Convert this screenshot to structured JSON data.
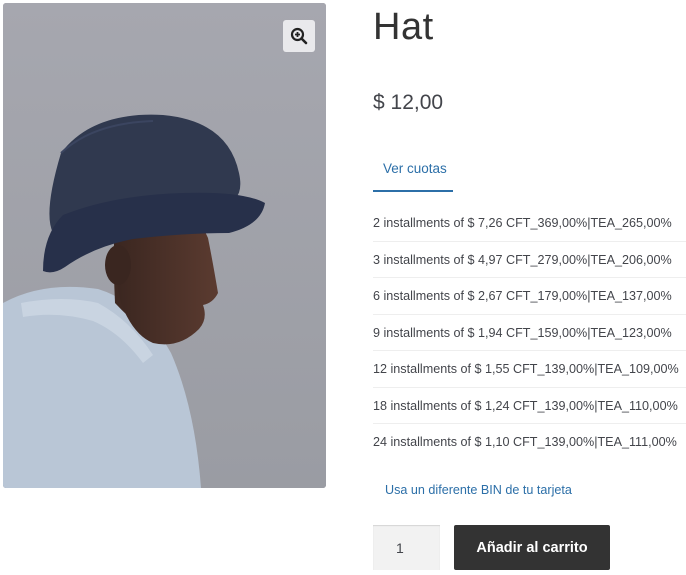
{
  "product": {
    "title": "Hat",
    "price": "$ 12,00",
    "image_alt": "Man wearing a navy bucket hat",
    "zoom_icon": "zoom-in-icon"
  },
  "installments_tab": {
    "label": "Ver cuotas",
    "items": [
      "2 installments of $ 7,26 CFT_369,00%|TEA_265,00%",
      "3 installments of $ 4,97 CFT_279,00%|TEA_206,00%",
      "6 installments of $ 2,67 CFT_179,00%|TEA_137,00%",
      "9 installments of $ 1,94 CFT_159,00%|TEA_123,00%",
      "12 installments of $ 1,55 CFT_139,00%|TEA_109,00%",
      "18 installments of $ 1,24 CFT_139,00%|TEA_110,00%",
      "24 installments of $ 1,10 CFT_139,00%|TEA_111,00%"
    ],
    "bin_link": "Usa un diferente BIN de tu tarjeta"
  },
  "cart": {
    "quantity": "1",
    "add_button_label": "Añadir al carrito"
  },
  "colors": {
    "link": "#2c6fa8",
    "button_bg": "#333333",
    "text": "#43454b"
  }
}
